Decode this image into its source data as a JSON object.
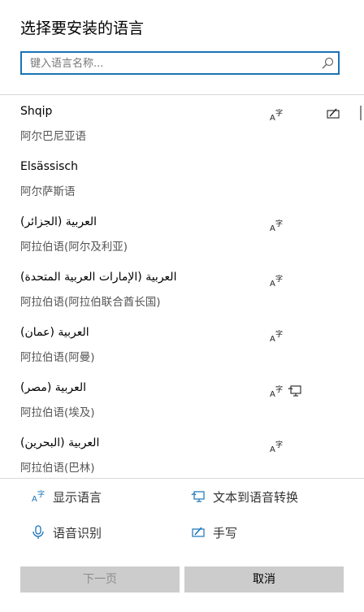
{
  "dialog": {
    "title": "选择要安装的语言",
    "search_placeholder": "键入语言名称..."
  },
  "languages": [
    {
      "name": "Shqip",
      "sub": "阿尔巴尼亚语",
      "features": [
        "display-language",
        "handwriting"
      ]
    },
    {
      "name": "Elsässisch",
      "sub": "阿尔萨斯语",
      "features": []
    },
    {
      "name": "العربية (الجزائر)",
      "sub": "阿拉伯语(阿尔及利亚)",
      "features": [
        "display-language"
      ]
    },
    {
      "name": "العربية (الإمارات العربية المتحدة)",
      "sub": "阿拉伯语(阿拉伯联合酋长国)",
      "features": [
        "display-language"
      ]
    },
    {
      "name": "العربية (عمان)",
      "sub": "阿拉伯语(阿曼)",
      "features": [
        "display-language"
      ]
    },
    {
      "name": "العربية (مصر)",
      "sub": "阿拉伯语(埃及)",
      "features": [
        "display-language",
        "text-to-speech"
      ]
    },
    {
      "name": "العربية (البحرين)",
      "sub": "阿拉伯语(巴林)",
      "features": [
        "display-language"
      ]
    }
  ],
  "legend": {
    "display_language": "显示语言",
    "text_to_speech": "文本到语音转换",
    "speech_recognition": "语音识别",
    "handwriting": "手写"
  },
  "buttons": {
    "next": "下一页",
    "cancel": "取消"
  },
  "colors": {
    "accent": "#1a73b8",
    "button_bg": "#cccccc"
  }
}
